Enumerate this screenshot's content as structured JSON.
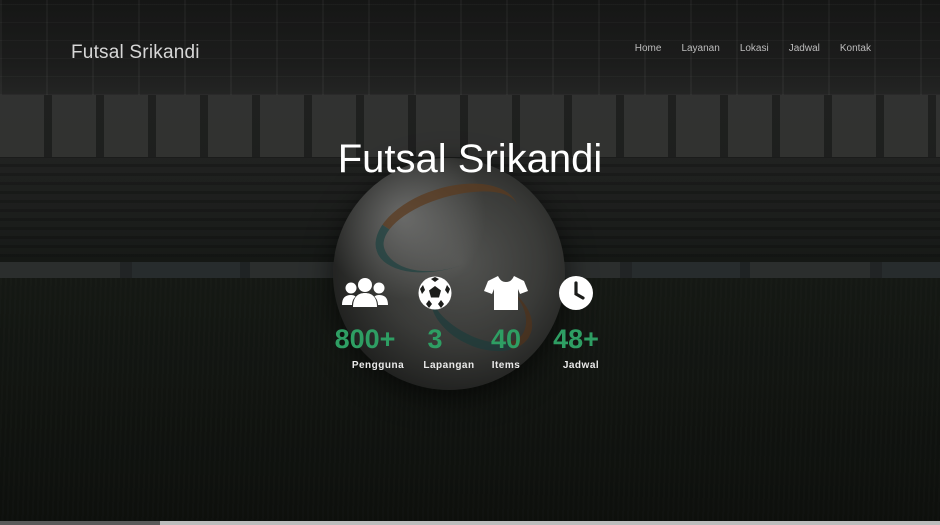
{
  "brand": "Futsal Srikandi",
  "nav": [
    {
      "label": "Home"
    },
    {
      "label": "Layanan"
    },
    {
      "label": "Lokasi"
    },
    {
      "label": "Jadwal"
    },
    {
      "label": "Kontak"
    }
  ],
  "hero": {
    "title": "Futsal Srikandi"
  },
  "stats": [
    {
      "icon": "users-icon",
      "value": "800+",
      "label": "Pengguna"
    },
    {
      "icon": "soccer-ball-icon",
      "value": "3",
      "label": "Lapangan"
    },
    {
      "icon": "tshirt-icon",
      "value": "40",
      "label": "Items"
    },
    {
      "icon": "clock-icon",
      "value": "48+",
      "label": "Jadwal"
    }
  ],
  "colors": {
    "accent": "#2e9e63",
    "text": "#ffffff",
    "nav_text": "#bdbdbd"
  }
}
